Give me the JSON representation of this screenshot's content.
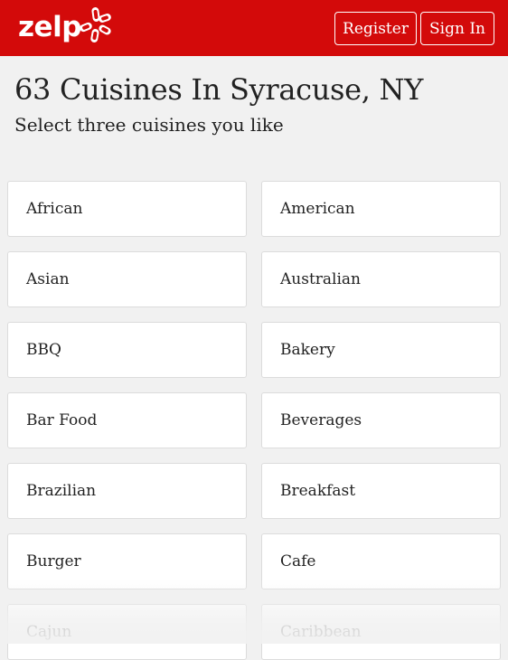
{
  "header": {
    "logo_text": "zelp",
    "logo_icon": "burst-icon",
    "register_label": "Register",
    "signin_label": "Sign In",
    "brand_color": "#d30a0a"
  },
  "main": {
    "title": "63 Cuisines In Syracuse, NY",
    "subtitle": "Select three cuisines you like",
    "cuisines": [
      "African",
      "American",
      "Asian",
      "Australian",
      "BBQ",
      "Bakery",
      "Bar Food",
      "Beverages",
      "Brazilian",
      "Breakfast",
      "Burger",
      "Cafe",
      "Cajun",
      "Caribbean"
    ]
  }
}
